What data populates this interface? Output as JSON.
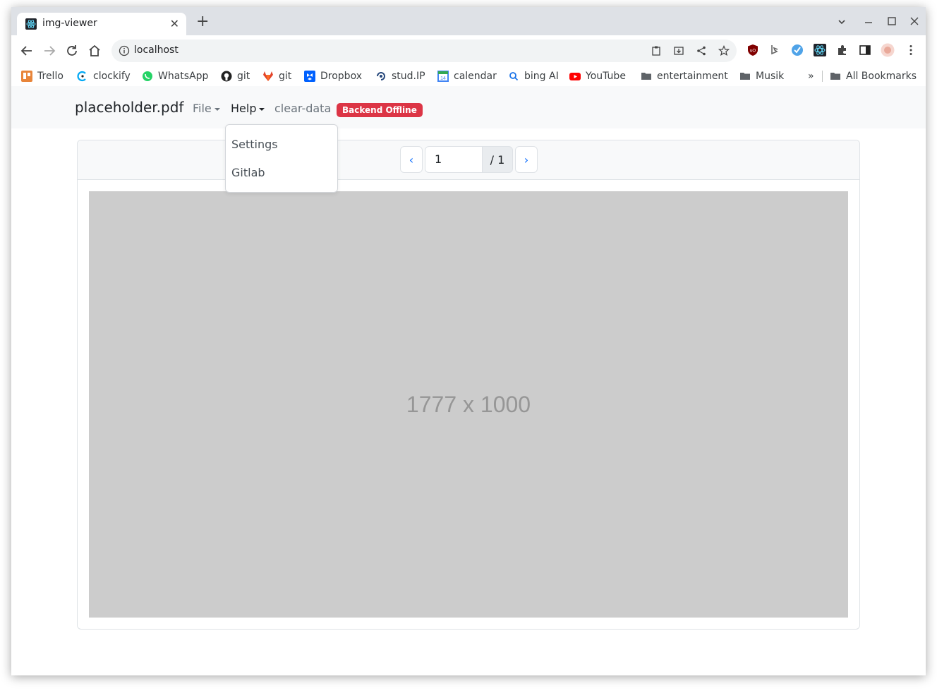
{
  "browser": {
    "tab_title": "img-viewer",
    "url": "localhost",
    "bookmarks": [
      {
        "label": "Trello",
        "icon": "trello-icon"
      },
      {
        "label": "clockify",
        "icon": "clockify-icon"
      },
      {
        "label": "WhatsApp",
        "icon": "whatsapp-icon"
      },
      {
        "label": "git",
        "icon": "github-icon"
      },
      {
        "label": "git",
        "icon": "gitlab-icon"
      },
      {
        "label": "Dropbox",
        "icon": "dropbox-icon"
      },
      {
        "label": "stud.IP",
        "icon": "studip-icon"
      },
      {
        "label": "calendar",
        "icon": "calendar-icon"
      },
      {
        "label": "bing AI",
        "icon": "bing-icon"
      },
      {
        "label": "YouTube",
        "icon": "youtube-icon"
      },
      {
        "label": "entertainment",
        "icon": "folder-icon"
      },
      {
        "label": "Musik",
        "icon": "folder-icon"
      }
    ],
    "overflow_label": "»",
    "all_bookmarks_label": "All Bookmarks"
  },
  "app": {
    "brand": "placeholder.pdf",
    "nav": {
      "file_label": "File",
      "help_label": "Help",
      "clear_label": "clear-data"
    },
    "status_badge": "Backend Offline",
    "help_menu": [
      "Settings",
      "Gitlab"
    ],
    "pager": {
      "prev": "‹",
      "next": "›",
      "current_page": "1",
      "total": "/ 1"
    },
    "image_label": "1777 x 1000"
  },
  "colors": {
    "danger": "#dc3545",
    "link": "#0d6efd",
    "placeholder_bg": "#cccccc"
  }
}
